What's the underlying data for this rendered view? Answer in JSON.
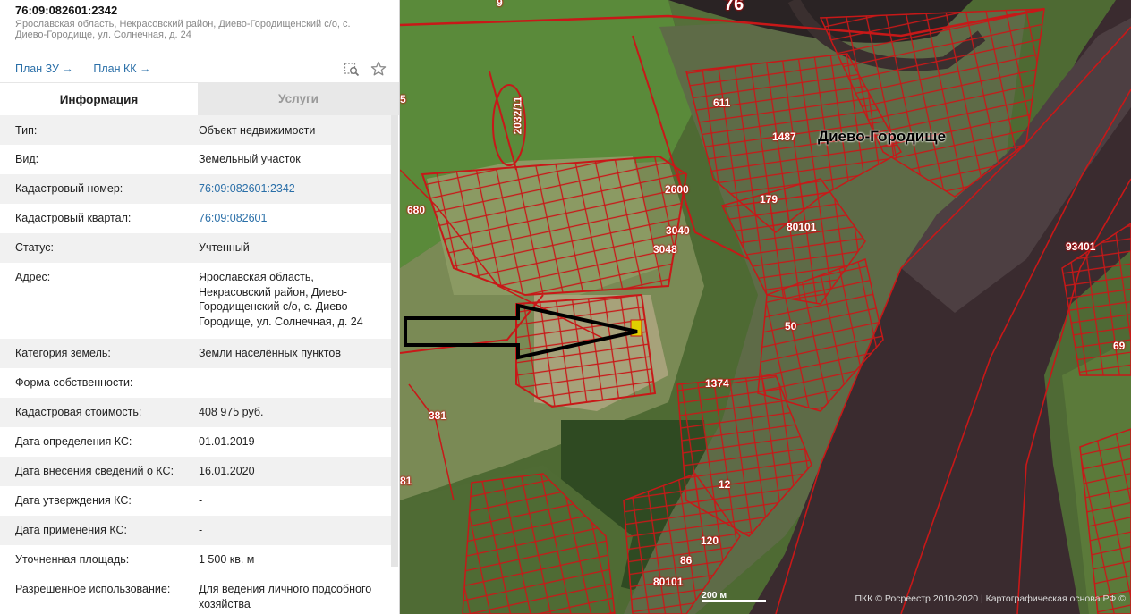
{
  "header": {
    "cad_number": "76:09:082601:2342",
    "address": "Ярославская область, Некрасовский район, Диево-Городищенский с/о, с. Диево-Городище, ул. Солнечная, д. 24",
    "link_plan_zu": "План ЗУ →",
    "link_plan_kk": "План КК →"
  },
  "tabs": {
    "info": "Информация",
    "services": "Услуги"
  },
  "fields": [
    {
      "key": "Тип:",
      "value": "Объект недвижимости"
    },
    {
      "key": "Вид:",
      "value": "Земельный участок"
    },
    {
      "key": "Кадастровый номер:",
      "value": "76:09:082601:2342"
    },
    {
      "key": "Кадастровый квартал:",
      "value": "76:09:082601"
    },
    {
      "key": "Статус:",
      "value": "Учтенный"
    },
    {
      "key": "Адрес:",
      "value": "Ярославская область, Некрасовский район, Диево-Городищенский с/о, с. Диево-Городище, ул. Солнечная, д. 24"
    },
    {
      "key": "Категория земель:",
      "value": "Земли населённых пунктов"
    },
    {
      "key": "Форма собственности:",
      "value": "-"
    },
    {
      "key": "Кадастровая стоимость:",
      "value": "408 975 руб."
    },
    {
      "key": "Дата определения КС:",
      "value": "01.01.2019"
    },
    {
      "key": "Дата внесения сведений о КС:",
      "value": "16.01.2020"
    },
    {
      "key": "Дата утверждения КС:",
      "value": "-"
    },
    {
      "key": "Дата применения КС:",
      "value": "-"
    },
    {
      "key": "Уточненная площадь:",
      "value": "1 500 кв. м"
    },
    {
      "key": "Разрешенное использование:",
      "value": "Для ведения личного подсобного хозяйства"
    }
  ],
  "map": {
    "place_name": "Диево-Городище",
    "labels": [
      "76",
      "9",
      "2032/11",
      "611",
      "1487",
      "680",
      "2600",
      "179",
      "3040",
      "3048",
      "80101",
      "93401",
      "50",
      "69",
      "1374",
      "381",
      "12",
      "120",
      "86",
      "80101",
      "5",
      "81"
    ],
    "scale_label": "200 м",
    "copyright": "ПКК © Росреестр 2010-2020 | Картографическая основа РФ ©"
  }
}
